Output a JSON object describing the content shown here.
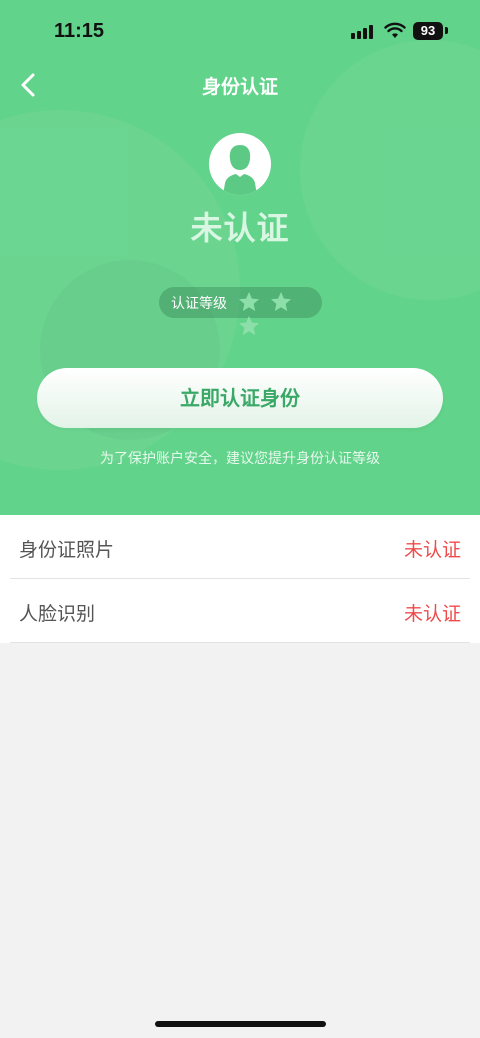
{
  "status_bar": {
    "time": "11:15",
    "battery": "93"
  },
  "nav": {
    "title": "身份认证"
  },
  "profile": {
    "status": "未认证"
  },
  "level": {
    "label": "认证等级",
    "stars_filled": 0,
    "stars_total": 3
  },
  "action": {
    "button_label": "立即认证身份",
    "tip": "为了保护账户安全，建议您提升身份认证等级"
  },
  "items": [
    {
      "label": "身份证照片",
      "status": "未认证"
    },
    {
      "label": "人脸识别",
      "status": "未认证"
    }
  ],
  "colors": {
    "primary": "#62d38a",
    "button_text": "#3aa866",
    "alert": "#ef4b4b"
  }
}
